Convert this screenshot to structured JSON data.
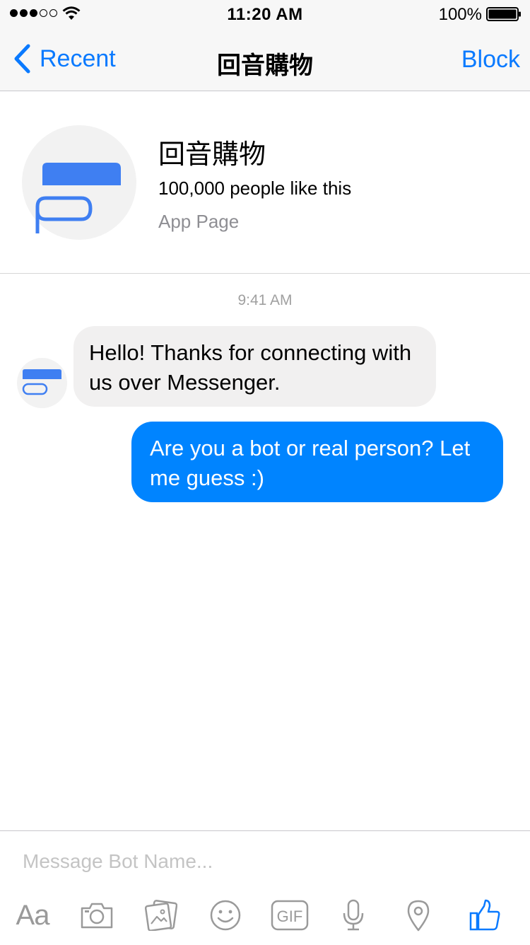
{
  "status_bar": {
    "time": "11:20 AM",
    "battery": "100%"
  },
  "nav": {
    "back_label": "Recent",
    "title": "回音購物",
    "block_label": "Block"
  },
  "page": {
    "name": "回音購物",
    "likes": "100,000 people like this",
    "type": "App Page"
  },
  "conversation": {
    "timestamp": "9:41 AM",
    "messages": [
      {
        "from": "bot",
        "text": "Hello! Thanks for connecting with us over Messenger."
      },
      {
        "from": "user",
        "text": "Are you a bot or real person? Let me guess :)"
      }
    ]
  },
  "composer": {
    "placeholder": "Message Bot Name...",
    "tools": [
      "text-format-icon",
      "camera-icon",
      "photo-icon",
      "emoji-icon",
      "gif-icon",
      "microphone-icon",
      "location-icon",
      "like-icon"
    ],
    "text_format_label": "Aa",
    "gif_label": "GIF"
  },
  "colors": {
    "accent": "#0a7aff",
    "outgoing_bubble": "#0084ff",
    "incoming_bubble": "#f1f0f0",
    "brand_logo": "#3f7ff2"
  }
}
